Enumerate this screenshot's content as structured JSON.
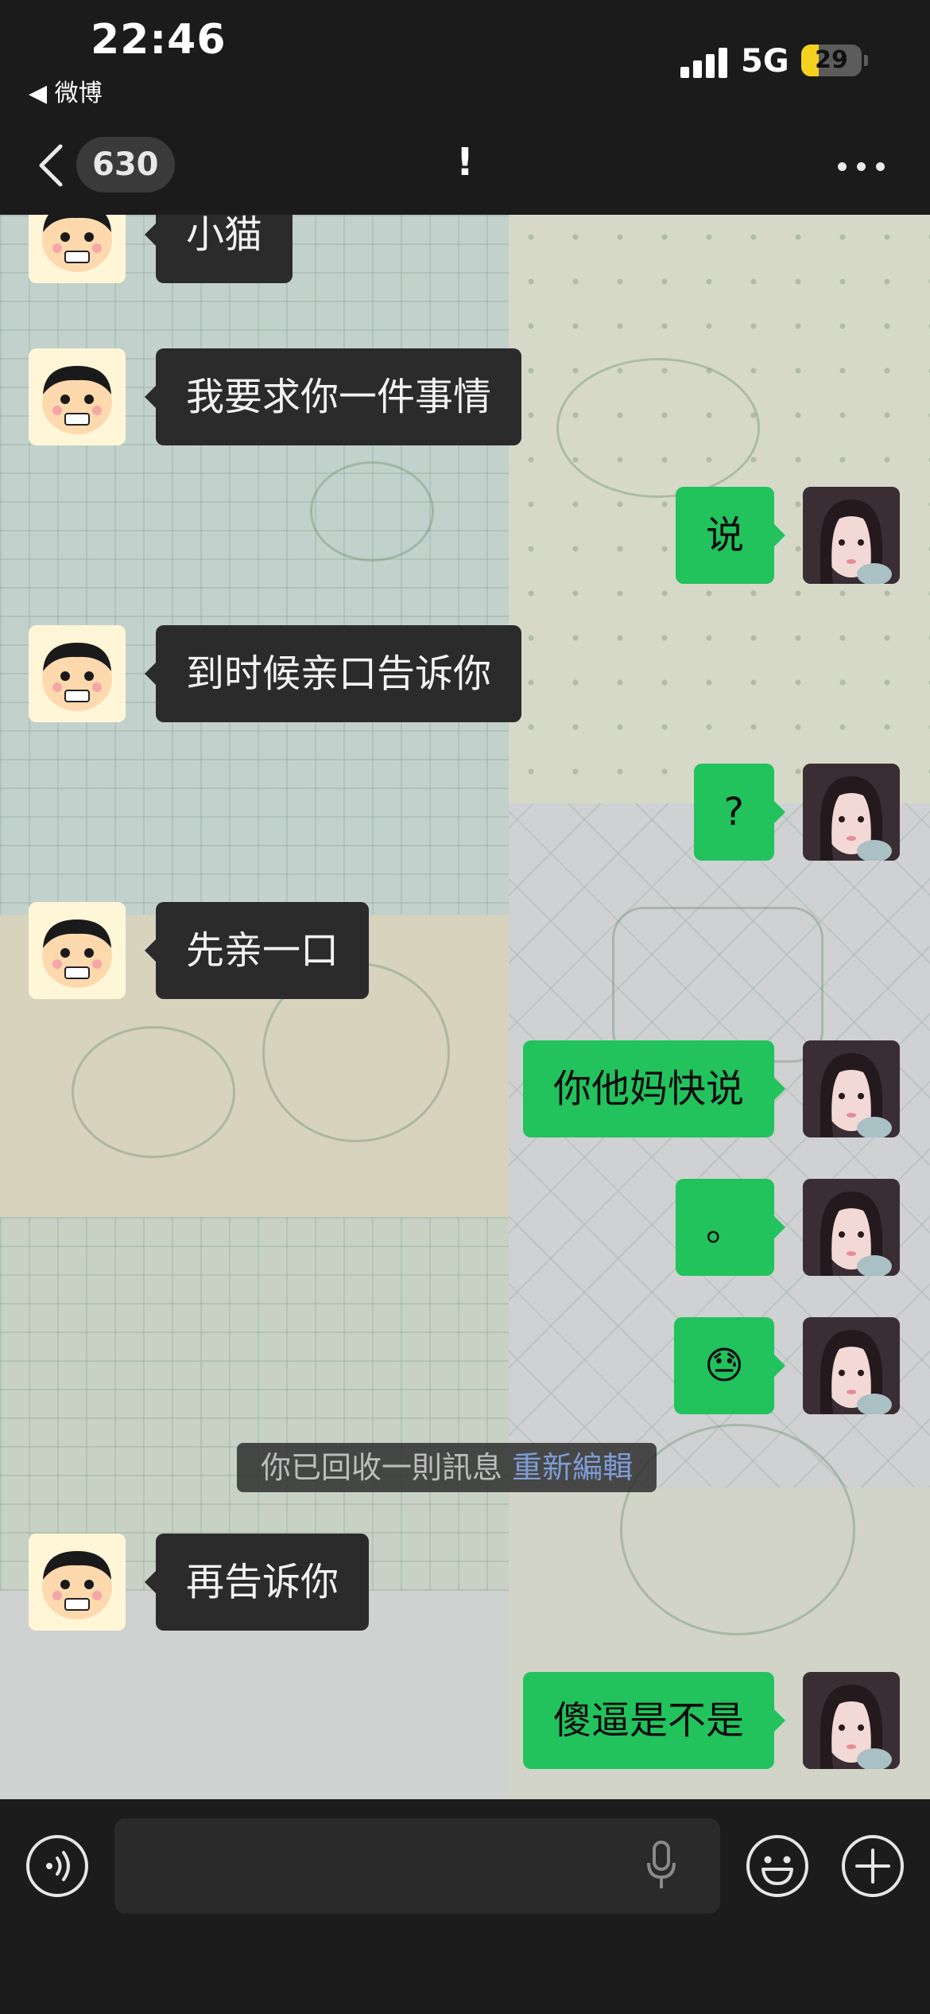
{
  "status_bar": {
    "time": "22:46",
    "back_app": "◀ 微博",
    "network": "5G",
    "battery": "29",
    "battery_level": 0.29
  },
  "nav": {
    "unread_count": "630",
    "title": "!"
  },
  "messages": [
    {
      "side": "left",
      "text": "小猫"
    },
    {
      "side": "left",
      "text": "我要求你一件事情"
    },
    {
      "side": "right",
      "text": "说"
    },
    {
      "side": "left",
      "text": "到时候亲口告诉你"
    },
    {
      "side": "right",
      "text": "?"
    },
    {
      "side": "left",
      "text": "先亲一口"
    },
    {
      "side": "right",
      "text": "你他妈快说"
    },
    {
      "side": "right",
      "text": "。"
    },
    {
      "side": "right",
      "text": "😓"
    },
    {
      "side": "left",
      "text": "再告诉你"
    },
    {
      "side": "right",
      "text": "傻逼是不是"
    }
  ],
  "recall_notice": {
    "text": "你已回收一則訊息",
    "action": "重新編輯"
  },
  "input": {
    "placeholder": ""
  },
  "colors": {
    "bubble_self": "#22c25d",
    "bubble_other": "#2b2b2b",
    "link": "#7e9dd6"
  },
  "icons": [
    "voice-icon",
    "microphone-icon",
    "emoji-icon",
    "plus-icon",
    "back-chevron-icon",
    "more-icon"
  ]
}
